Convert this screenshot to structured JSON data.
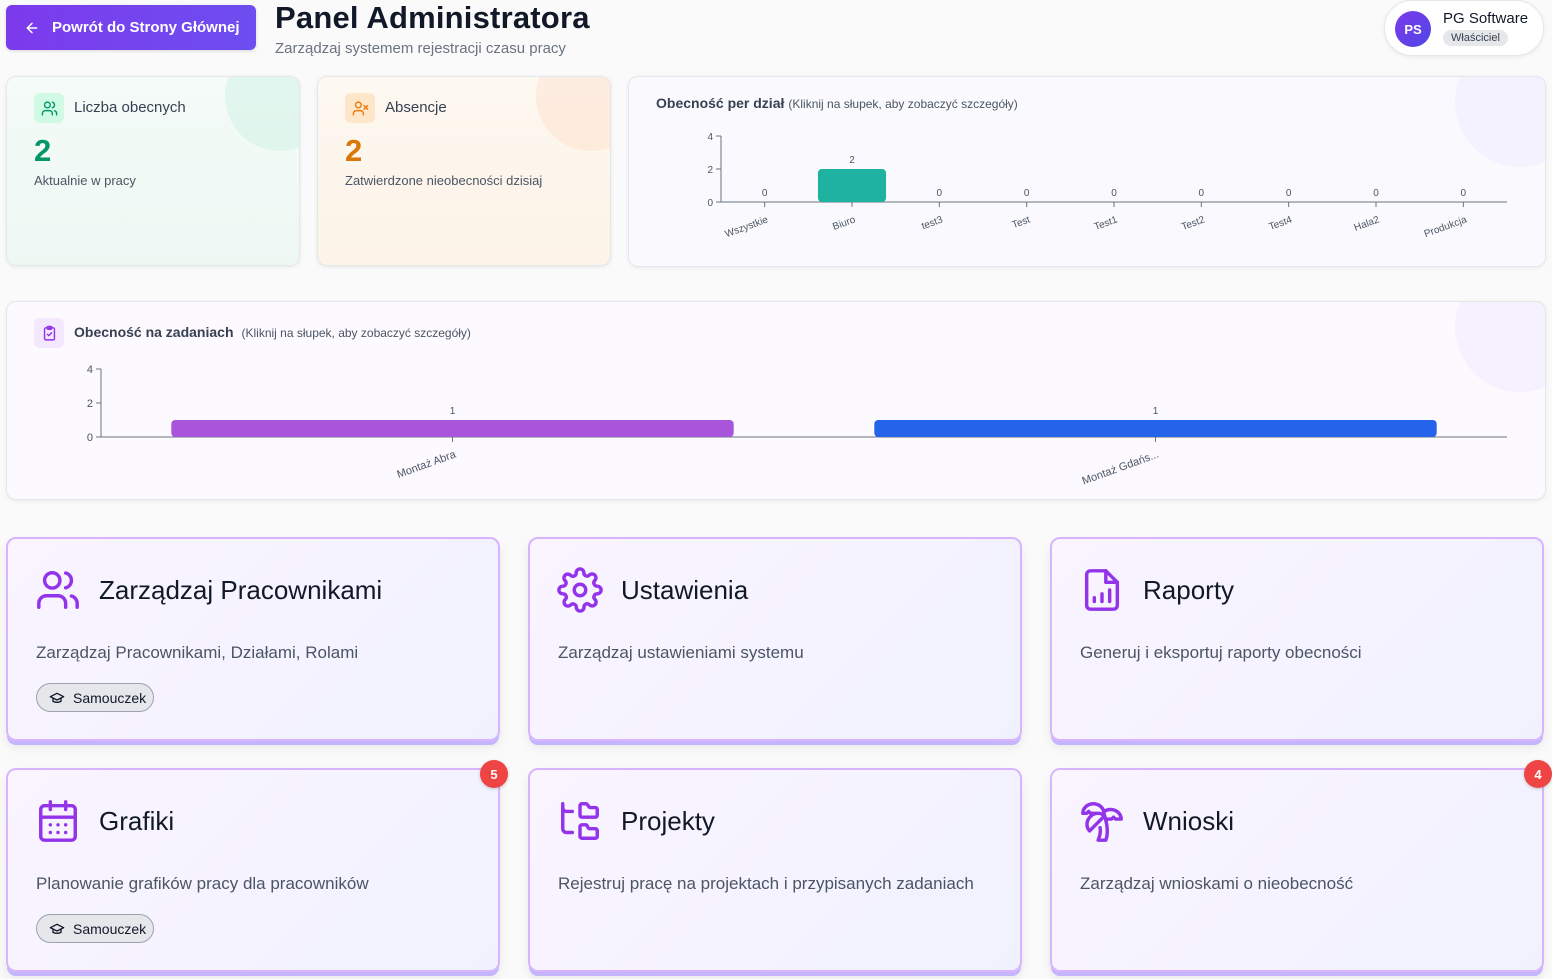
{
  "header": {
    "back_label": "Powrót do Strony Głównej",
    "title": "Panel Administratora",
    "subtitle": "Zarządzaj systemem rejestracji czasu pracy"
  },
  "user": {
    "initials": "PS",
    "name": "PG Software",
    "role": "Właściciel"
  },
  "stats": {
    "present": {
      "label": "Liczba obecnych",
      "value": "2",
      "description": "Aktualnie w pracy"
    },
    "absences": {
      "label": "Absencje",
      "value": "2",
      "description": "Zatwierdzone nieobecności dzisiaj"
    }
  },
  "dept_chart": {
    "title": "Obecność per dział",
    "hint": "(Kliknij na słupek, aby zobaczyć szczegóły)"
  },
  "task_chart": {
    "title": "Obecność na zadaniach",
    "hint": "(Kliknij na słupek, aby zobaczyć szczegóły)"
  },
  "chart_data": [
    {
      "type": "bar",
      "title": "Obecność per dział",
      "categories": [
        "Wszystkie",
        "Biuro",
        "test3",
        "Test",
        "Test1",
        "Test2",
        "Test4",
        "Hala2",
        "Produkcja"
      ],
      "values": [
        0,
        2,
        0,
        0,
        0,
        0,
        0,
        0,
        0
      ],
      "colors": [
        "#20b2a0"
      ],
      "ylim": [
        0,
        4
      ],
      "yticks": [
        0,
        2,
        4
      ],
      "grid": false
    },
    {
      "type": "bar",
      "title": "Obecność na zadaniach",
      "categories": [
        "Montaż Abra",
        "Montaż Gdańs..."
      ],
      "values": [
        1,
        1
      ],
      "colors": [
        "#a855db",
        "#2563eb"
      ],
      "ylim": [
        0,
        4
      ],
      "yticks": [
        0,
        2,
        4
      ],
      "grid": false
    }
  ],
  "nav": {
    "employees": {
      "title": "Zarządzaj Pracownikami",
      "description": "Zarządzaj Pracownikami, Działami, Rolami",
      "tutorial": "Samouczek"
    },
    "settings": {
      "title": "Ustawienia",
      "description": "Zarządzaj ustawieniami systemu"
    },
    "reports": {
      "title": "Raporty",
      "description": "Generuj i eksportuj raporty obecności"
    },
    "schedules": {
      "title": "Grafiki",
      "description": "Planowanie grafików pracy dla pracowników",
      "tutorial": "Samouczek",
      "badge": "5"
    },
    "projects": {
      "title": "Projekty",
      "description": "Rejestruj pracę na projektach i przypisanych zadaniach"
    },
    "requests": {
      "title": "Wnioski",
      "description": "Zarządzaj wnioskami o nieobecność",
      "badge": "4"
    }
  },
  "icons": {
    "back": "arrow-left-icon",
    "present": "users-icon",
    "absences": "user-x-icon",
    "tasks": "clipboard-check-icon",
    "employees": "users-icon",
    "settings": "gear-icon",
    "reports": "file-chart-icon",
    "schedules": "calendar-icon",
    "projects": "folder-tree-icon",
    "requests": "palm-tree-icon",
    "tutorial": "graduation-cap-icon"
  },
  "colors": {
    "primary": "#7c3aed",
    "success": "#059669",
    "warning": "#d97706",
    "badge": "#ef4444",
    "accent_purple": "#9333ea"
  }
}
